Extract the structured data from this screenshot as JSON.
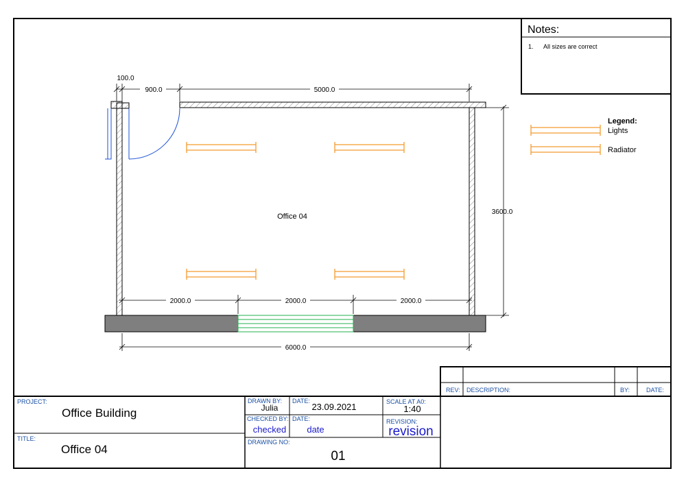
{
  "notes": {
    "title": "Notes:",
    "items": [
      {
        "num": "1.",
        "text": "All sizes are correct"
      }
    ]
  },
  "legend": {
    "title": "Legend:",
    "items": [
      {
        "label": "Lights",
        "color": "#f39a2e"
      },
      {
        "label": "Radiator",
        "color": "#f39a2e"
      }
    ]
  },
  "plan": {
    "room_label": "Office 04",
    "dims": {
      "wall": "100.0",
      "door": "900.0",
      "top": "5000.0",
      "right": "3600.0",
      "seg1": "2000.0",
      "seg2": "2000.0",
      "seg3": "2000.0",
      "total": "6000.0"
    },
    "colors": {
      "door": "#1a4fd6",
      "fixture": "#f39a2e",
      "window": "#22b14c",
      "wall_fill": "#7f7f7f"
    }
  },
  "revisions": {
    "rev_label": "REV:",
    "description_label": "DESCRIPTION:",
    "by_label": "BY:",
    "date_label": "DATE:"
  },
  "title_block": {
    "project_label": "PROJECT:",
    "project": "Office Building",
    "title_label": "TITLE:",
    "title": "Office 04",
    "drawn_by_label": "DRAWN BY:",
    "drawn_by": "Julia",
    "date_label": "DATE:",
    "date": "23.09.2021",
    "scale_label": "SCALE AT A0:",
    "scale": "1:40",
    "checked_by_label": "CHECKED BY:",
    "checked_by": "checked",
    "checked_date_label": "DATE:",
    "checked_date": "date",
    "revision_label": "REVISION:",
    "revision": "revision",
    "drawing_no_label": "DRAWING NO:",
    "drawing_no": "01"
  }
}
